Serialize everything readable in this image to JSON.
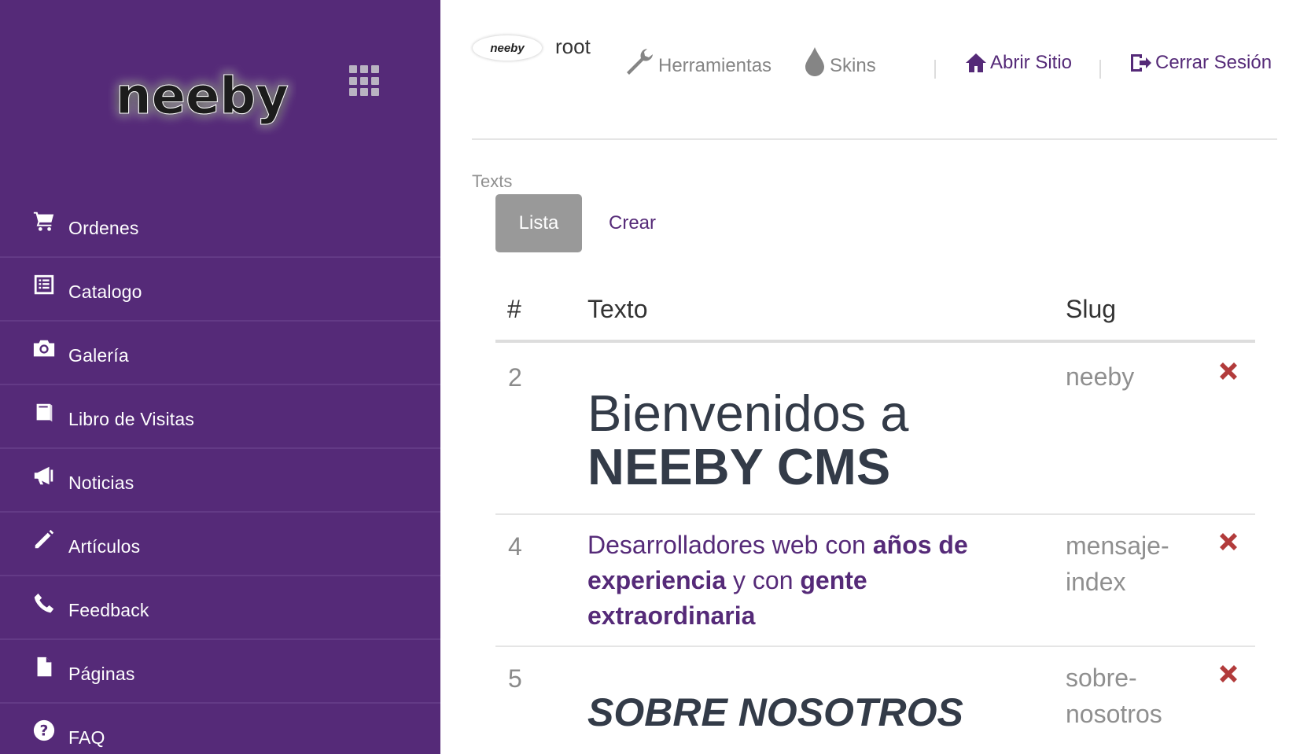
{
  "brand": {
    "logo_text": "neeby"
  },
  "sidebar": {
    "items": [
      {
        "label": "Ordenes",
        "icon": "cart-icon"
      },
      {
        "label": "Catalogo",
        "icon": "list-icon"
      },
      {
        "label": "Galería",
        "icon": "camera-icon"
      },
      {
        "label": "Libro de Visitas",
        "icon": "book-icon"
      },
      {
        "label": "Noticias",
        "icon": "megaphone-icon"
      },
      {
        "label": "Artículos",
        "icon": "pencil-icon"
      },
      {
        "label": "Feedback",
        "icon": "phone-icon"
      },
      {
        "label": "Páginas",
        "icon": "file-icon"
      },
      {
        "label": "FAQ",
        "icon": "question-icon"
      }
    ]
  },
  "topbar": {
    "avatar_text": "neeby",
    "username": "root",
    "tools_label": "Herramientas",
    "skins_label": "Skins",
    "open_site_label": "Abrir Sitio",
    "logout_label": "Cerrar Sesión"
  },
  "content": {
    "section_title": "Texts",
    "tabs": {
      "list": "Lista",
      "create": "Crear"
    },
    "table": {
      "headers": {
        "id": "#",
        "text": "Texto",
        "slug": "Slug"
      },
      "rows": [
        {
          "id": "2",
          "text_line1": "Bienvenidos a",
          "text_line2": "NEEBY CMS",
          "slug": "neeby"
        },
        {
          "id": "4",
          "text_a": "Desarrolladores web con ",
          "text_b": "años de experiencia",
          "text_c": " y con ",
          "text_d": "gente extraordinaria",
          "slug": "mensaje-index"
        },
        {
          "id": "5",
          "text": "SOBRE NOSOTROS",
          "slug": "sobre-nosotros"
        }
      ]
    }
  },
  "colors": {
    "sidebar_bg": "#552a78",
    "accent": "#552a78",
    "delete": "#b23b3b",
    "tab_active_bg": "#999999"
  }
}
